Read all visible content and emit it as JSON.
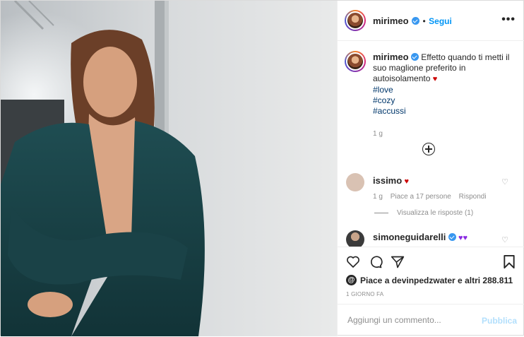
{
  "post": {
    "username": "mirimeo",
    "separator": "•",
    "follow_label": "Segui",
    "more_label": "•••",
    "caption_text": "Effetto quando ti metti il suo maglione preferito in autoisolamento",
    "hashtags": [
      "#love",
      "#cozy",
      "#accussi"
    ],
    "caption_age": "1 g",
    "likes_text": "Piace a devinpedzwater e altri 288.811",
    "date_label": "1 GIORNO FA",
    "comment_placeholder": "Aggiungi un commento...",
    "publish_label": "Pubblica"
  },
  "comments": [
    {
      "username": "issimo",
      "age": "1 g",
      "likes": "Piace a 17 persone",
      "reply_label": "Rispondi",
      "view_replies": "Visualizza le risposte (1)"
    },
    {
      "username": "simoneguidarelli"
    }
  ],
  "colors": {
    "accent": "#0095f6",
    "verified": "#3897f0",
    "text": "#262626",
    "muted": "#8e8e8e",
    "publish": "#b2dffc"
  },
  "icons": [
    "verified-badge-icon",
    "more-options-icon",
    "add-comment-plus-icon",
    "heart-icon",
    "comment-icon",
    "share-icon",
    "bookmark-icon",
    "threads-icon"
  ]
}
